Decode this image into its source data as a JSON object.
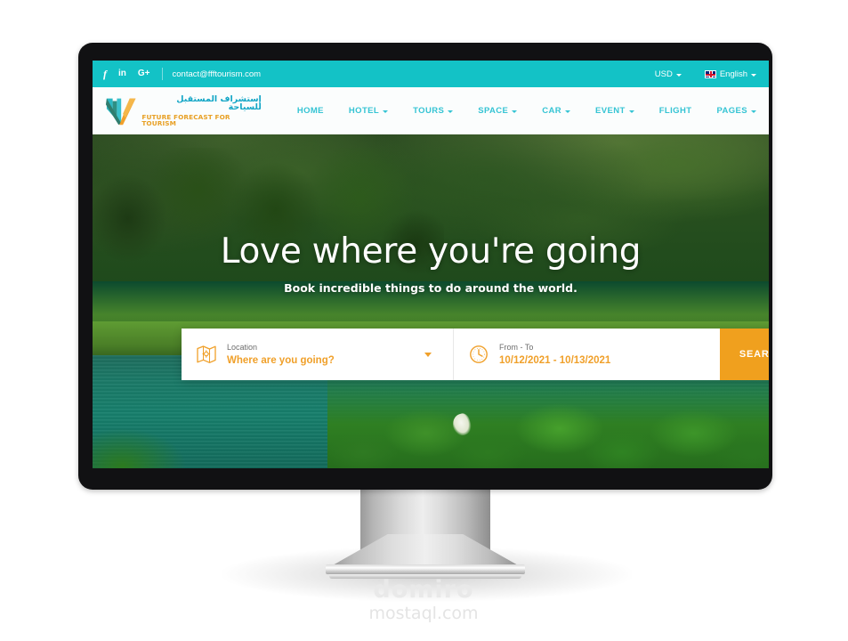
{
  "site": {
    "topbar": {
      "social": [
        {
          "name": "facebook-icon",
          "glyph": "f"
        },
        {
          "name": "linkedin-icon",
          "glyph": "in"
        },
        {
          "name": "googleplus-icon",
          "glyph": "G+"
        }
      ],
      "email": "contact@ffftourism.com",
      "currency": "USD",
      "language": "English"
    },
    "logo": {
      "arabic": "إستشراف المستقبل للسياحة",
      "english_1": "FUTURE FORECAST FOR ",
      "english_2": "TOURISM"
    },
    "nav": [
      {
        "label": "HOME",
        "has_dropdown": false
      },
      {
        "label": "HOTEL",
        "has_dropdown": true
      },
      {
        "label": "TOURS",
        "has_dropdown": true
      },
      {
        "label": "SPACE",
        "has_dropdown": true
      },
      {
        "label": "CAR",
        "has_dropdown": true
      },
      {
        "label": "EVENT",
        "has_dropdown": true
      },
      {
        "label": "FLIGHT",
        "has_dropdown": false
      },
      {
        "label": "PAGES",
        "has_dropdown": true
      }
    ],
    "hero": {
      "title": "Love where you're going",
      "subtitle": "Book incredible things to do around the world."
    },
    "search": {
      "location_label": "Location",
      "location_value": "Where are you going?",
      "dates_label": "From - To",
      "dates_value": "10/12/2021 - 10/13/2021",
      "button_label": "SEARCH"
    },
    "colors": {
      "topbar_teal": "#13c2c6",
      "nav_teal": "#35c4d4",
      "accent_orange": "#f0a01e",
      "logo_blue": "#13a6c6"
    }
  },
  "watermark": {
    "mark": "domiro",
    "domain": "mostaql.com"
  }
}
